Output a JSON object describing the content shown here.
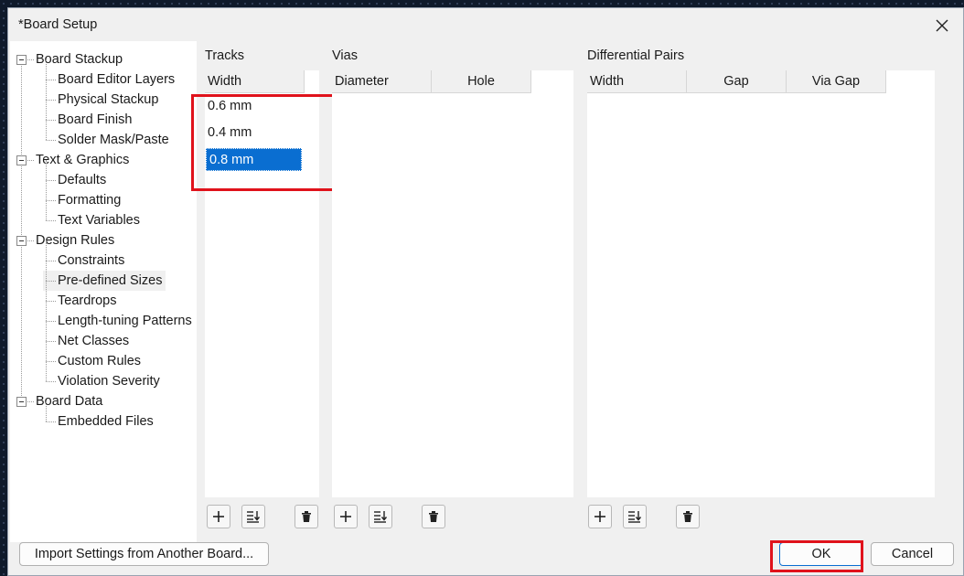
{
  "dialog": {
    "title": "*Board Setup"
  },
  "tree": {
    "items": [
      {
        "label": "Board Stackup",
        "level": 0
      },
      {
        "label": "Board Editor Layers",
        "level": 1
      },
      {
        "label": "Physical Stackup",
        "level": 1
      },
      {
        "label": "Board Finish",
        "level": 1
      },
      {
        "label": "Solder Mask/Paste",
        "level": 1
      },
      {
        "label": "Text & Graphics",
        "level": 0
      },
      {
        "label": "Defaults",
        "level": 1
      },
      {
        "label": "Formatting",
        "level": 1
      },
      {
        "label": "Text Variables",
        "level": 1
      },
      {
        "label": "Design Rules",
        "level": 0
      },
      {
        "label": "Constraints",
        "level": 1
      },
      {
        "label": "Pre-defined Sizes",
        "level": 1,
        "selected": true
      },
      {
        "label": "Teardrops",
        "level": 1
      },
      {
        "label": "Length-tuning Patterns",
        "level": 1
      },
      {
        "label": "Net Classes",
        "level": 1
      },
      {
        "label": "Custom Rules",
        "level": 1
      },
      {
        "label": "Violation Severity",
        "level": 1
      },
      {
        "label": "Board Data",
        "level": 0
      },
      {
        "label": "Embedded Files",
        "level": 1
      }
    ]
  },
  "tracks": {
    "label": "Tracks",
    "columns": [
      "Width"
    ],
    "rows": [
      "0.6 mm",
      "0.4 mm",
      "0.8 mm"
    ],
    "selected_row": 2
  },
  "vias": {
    "label": "Vias",
    "columns": [
      "Diameter",
      "Hole"
    ]
  },
  "diff_pairs": {
    "label": "Differential Pairs",
    "columns": [
      "Width",
      "Gap",
      "Via Gap"
    ]
  },
  "toolbar_icons": {
    "add": "plus-icon",
    "sort": "sort-icon",
    "delete": "trash-icon"
  },
  "buttons": {
    "import": "Import Settings from Another Board...",
    "ok": "OK",
    "cancel": "Cancel"
  },
  "colors": {
    "selection": "#0a6ed1",
    "annotation": "#e0121b"
  }
}
